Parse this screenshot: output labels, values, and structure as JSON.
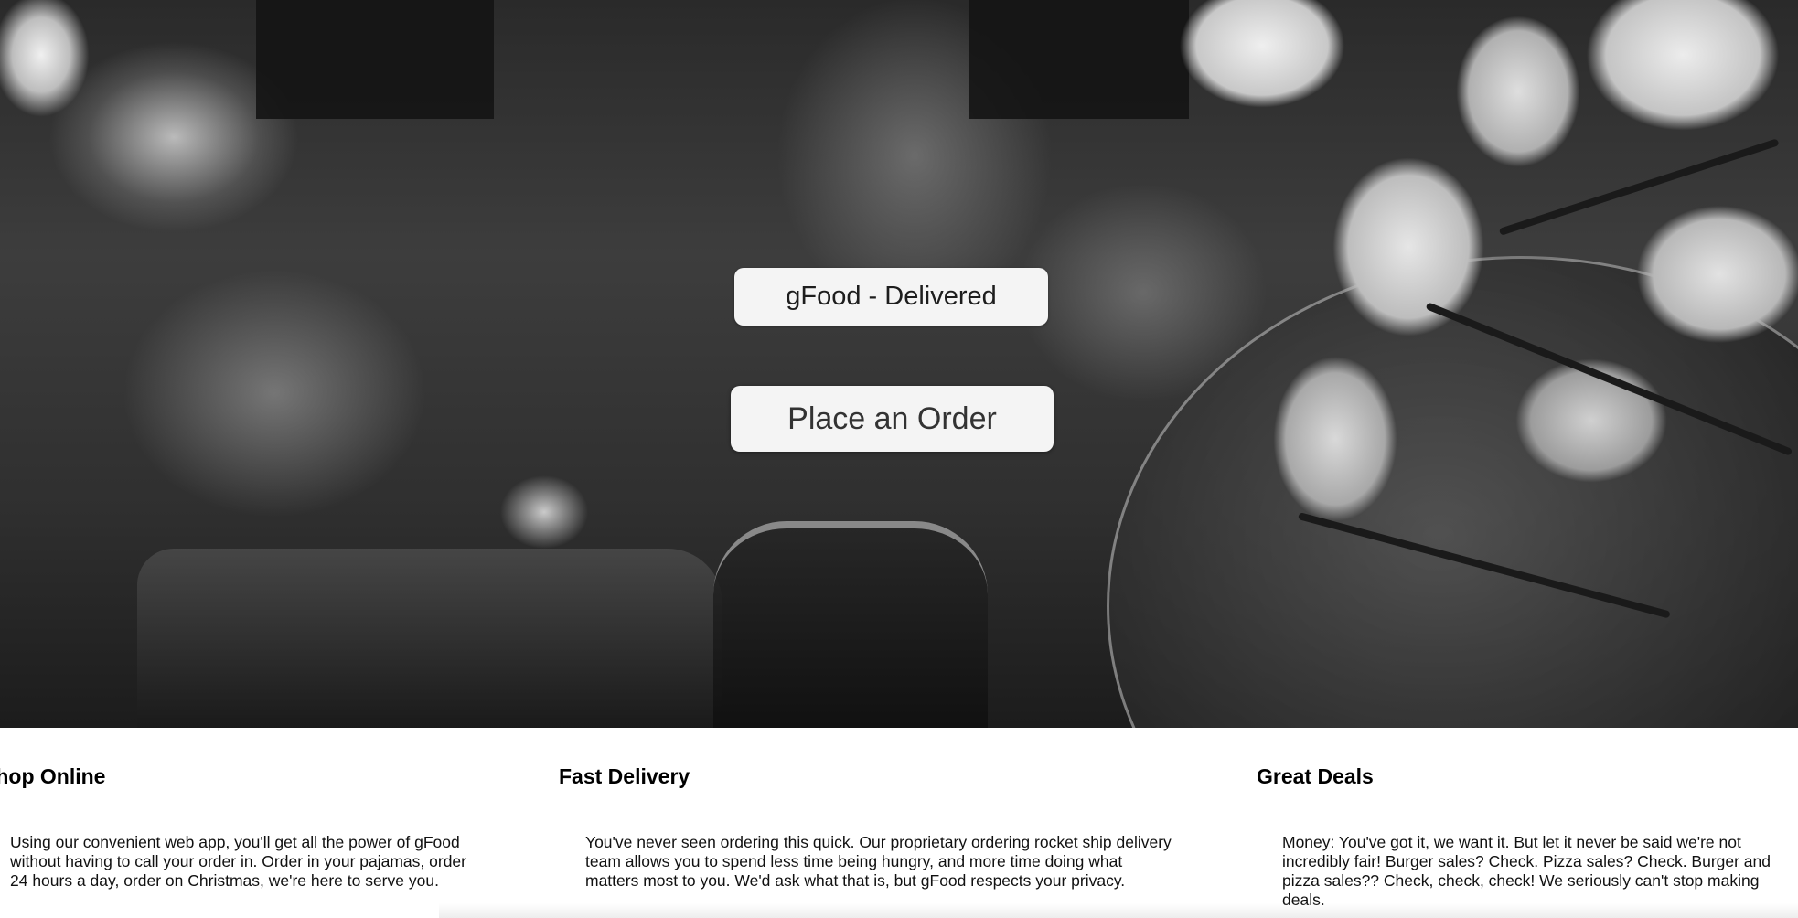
{
  "hero": {
    "title": "gFood - Delivered",
    "cta_label": "Place an Order"
  },
  "features": [
    {
      "heading": "Shop Online",
      "text": "Using our convenient web app, you'll get all the power of gFood without having to call your order in. Order in your pajamas, order 24 hours a day, order on Christmas, we're here to serve you."
    },
    {
      "heading": "Fast Delivery",
      "text": "You've never seen ordering this quick. Our proprietary ordering rocket ship delivery team allows you to spend less time being hungry, and more time doing what matters most to you. We'd ask what that is, but gFood respects your privacy."
    },
    {
      "heading": "Great Deals",
      "text": "Money: You've got it, we want it. But let it never be said we're not incredibly fair! Burger sales? Check. Pizza sales? Check. Burger and pizza sales?? Check, check, check! We seriously can't stop making deals."
    }
  ]
}
